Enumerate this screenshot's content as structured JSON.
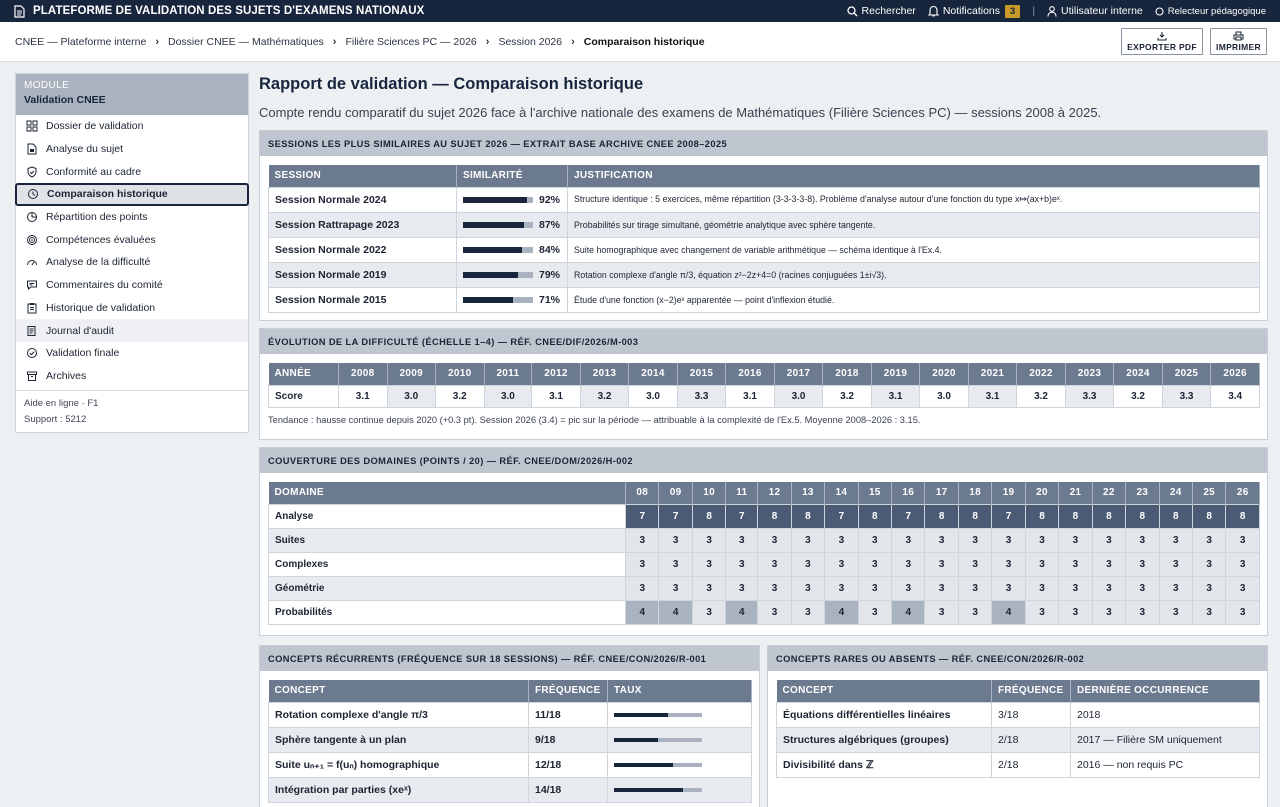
{
  "app": {
    "title": "PLATEFORME DE VALIDATION DES SUJETS D'EXAMENS NATIONAUX",
    "search": "Rechercher",
    "notifications": "Notifications",
    "notif_count": "3",
    "user": "Utilisateur interne",
    "selector": "Relecteur pédagogique"
  },
  "breadcrumb": [
    "CNEE — Plateforme interne",
    "Dossier CNEE — Mathématiques",
    "Filière Sciences PC — 2026",
    "Session 2026",
    "Comparaison historique"
  ],
  "toolbar": {
    "export": "EXPORTER PDF",
    "print": "IMPRIMER"
  },
  "sidebar": {
    "module": "MODULE",
    "title": "Validation CNEE",
    "items": [
      {
        "label": "Dossier de validation",
        "icon": "grid-icon"
      },
      {
        "label": "Analyse du sujet",
        "icon": "document-icon"
      },
      {
        "label": "Conformité au cadre",
        "icon": "shield-icon"
      },
      {
        "label": "Comparaison historique",
        "icon": "history-icon"
      },
      {
        "label": "Répartition des points",
        "icon": "pie-icon"
      },
      {
        "label": "Compétences évaluées",
        "icon": "target-icon"
      },
      {
        "label": "Analyse de la difficulté",
        "icon": "gauge-icon"
      },
      {
        "label": "Commentaires du comité",
        "icon": "comment-icon"
      },
      {
        "label": "Historique de validation",
        "icon": "clipboard-icon"
      },
      {
        "label": "Journal d'audit",
        "icon": "log-icon"
      },
      {
        "label": "Validation finale",
        "icon": "check-icon"
      },
      {
        "label": "Archives",
        "icon": "archive-icon"
      }
    ],
    "help": "Aide en ligne · F1",
    "support": "Support : 5212"
  },
  "page": {
    "title": "Rapport de validation — Comparaison historique",
    "intro": "Compte rendu comparatif du sujet 2026 face à l'archive nationale des examens de Mathématiques (Filière Sciences PC) — sessions 2008 à 2025."
  },
  "similar": {
    "title": "SESSIONS LES PLUS SIMILAIRES AU SUJET 2026 — EXTRAIT BASE ARCHIVE CNEE 2008–2025",
    "headers": [
      "SESSION",
      "SIMILARITÉ",
      "JUSTIFICATION"
    ],
    "rows": [
      {
        "session": "Session Normale 2024",
        "sim": 92,
        "pct": "92%",
        "just": "Structure identique : 5 exercices, même répartition (3-3-3-3-8). Problème d'analyse autour d'une fonction du type x↦(ax+b)eˣ."
      },
      {
        "session": "Session Rattrapage 2023",
        "sim": 87,
        "pct": "87%",
        "just": "Probabilités sur tirage simultané, géométrie analytique avec sphère tangente."
      },
      {
        "session": "Session Normale 2022",
        "sim": 84,
        "pct": "84%",
        "just": "Suite homographique avec changement de variable arithmétique — schéma identique à l'Ex.4."
      },
      {
        "session": "Session Normale 2019",
        "sim": 79,
        "pct": "79%",
        "just": "Rotation complexe d'angle π/3, équation z²−2z+4=0 (racines conjuguées 1±i√3)."
      },
      {
        "session": "Session Normale 2015",
        "sim": 71,
        "pct": "71%",
        "just": "Étude d'une fonction (x−2)eˣ apparentée — point d'inflexion étudié."
      }
    ]
  },
  "difficulty": {
    "title": "ÉVOLUTION DE LA DIFFICULTÉ (ÉCHELLE 1–4) — RÉF. CNEE/DIF/2026/M-003",
    "year_label": "ANNÉE",
    "score_label": "Score",
    "years": [
      "2008",
      "2009",
      "2010",
      "2011",
      "2012",
      "2013",
      "2014",
      "2015",
      "2016",
      "2017",
      "2018",
      "2019",
      "2020",
      "2021",
      "2022",
      "2023",
      "2024",
      "2025",
      "2026"
    ],
    "scores": [
      "3.1",
      "3.0",
      "3.2",
      "3.0",
      "3.1",
      "3.2",
      "3.0",
      "3.3",
      "3.1",
      "3.0",
      "3.2",
      "3.1",
      "3.0",
      "3.1",
      "3.2",
      "3.3",
      "3.2",
      "3.3",
      "3.4"
    ],
    "note": "Tendance : hausse continue depuis 2020 (+0.3 pt). Session 2026 (3.4) = pic sur la période — attribuable à la complexité de l'Ex.5. Moyenne 2008–2026 : 3.15."
  },
  "coverage": {
    "title": "COUVERTURE DES DOMAINES (POINTS / 20) — RÉF. CNEE/DOM/2026/H-002",
    "domain_label": "DOMAINE",
    "years": [
      "08",
      "09",
      "10",
      "11",
      "12",
      "13",
      "14",
      "15",
      "16",
      "17",
      "18",
      "19",
      "20",
      "21",
      "22",
      "23",
      "24",
      "25",
      "26"
    ],
    "rows": [
      {
        "name": "Analyse",
        "vals": [
          "7",
          "7",
          "8",
          "7",
          "8",
          "8",
          "7",
          "8",
          "7",
          "8",
          "8",
          "7",
          "8",
          "8",
          "8",
          "8",
          "8",
          "8",
          "8"
        ]
      },
      {
        "name": "Suites",
        "vals": [
          "3",
          "3",
          "3",
          "3",
          "3",
          "3",
          "3",
          "3",
          "3",
          "3",
          "3",
          "3",
          "3",
          "3",
          "3",
          "3",
          "3",
          "3",
          "3"
        ]
      },
      {
        "name": "Complexes",
        "vals": [
          "3",
          "3",
          "3",
          "3",
          "3",
          "3",
          "3",
          "3",
          "3",
          "3",
          "3",
          "3",
          "3",
          "3",
          "3",
          "3",
          "3",
          "3",
          "3"
        ]
      },
      {
        "name": "Géométrie",
        "vals": [
          "3",
          "3",
          "3",
          "3",
          "3",
          "3",
          "3",
          "3",
          "3",
          "3",
          "3",
          "3",
          "3",
          "3",
          "3",
          "3",
          "3",
          "3",
          "3"
        ]
      },
      {
        "name": "Probabilités",
        "vals": [
          "4",
          "4",
          "3",
          "4",
          "3",
          "3",
          "4",
          "3",
          "4",
          "3",
          "3",
          "4",
          "3",
          "3",
          "3",
          "3",
          "3",
          "3",
          "3"
        ]
      }
    ]
  },
  "recurrent": {
    "title": "CONCEPTS RÉCURRENTS (FRÉQUENCE SUR 18 SESSIONS) — RÉF. CNEE/CON/2026/R-001",
    "headers": [
      "CONCEPT",
      "FRÉQUENCE",
      "TAUX"
    ],
    "rows": [
      {
        "concept": "Rotation complexe d'angle π/3",
        "freq": "11/18",
        "rate": 0.61
      },
      {
        "concept": "Sphère tangente à un plan",
        "freq": "9/18",
        "rate": 0.5
      },
      {
        "concept": "Suite uₙ₊₁ = f(uₙ) homographique",
        "freq": "12/18",
        "rate": 0.67
      },
      {
        "concept": "Intégration par parties (xeˣ)",
        "freq": "14/18",
        "rate": 0.78
      }
    ]
  },
  "rare": {
    "title": "CONCEPTS RARES OU ABSENTS — RÉF. CNEE/CON/2026/R-002",
    "headers": [
      "CONCEPT",
      "FRÉQUENCE",
      "DERNIÈRE OCCURRENCE"
    ],
    "rows": [
      {
        "concept": "Équations différentielles linéaires",
        "freq": "3/18",
        "last": "2018"
      },
      {
        "concept": "Structures algébriques (groupes)",
        "freq": "2/18",
        "last": "2017 — Filière SM uniquement"
      },
      {
        "concept": "Divisibilité dans ℤ",
        "freq": "2/18",
        "last": "2016 — non requis PC"
      }
    ]
  }
}
